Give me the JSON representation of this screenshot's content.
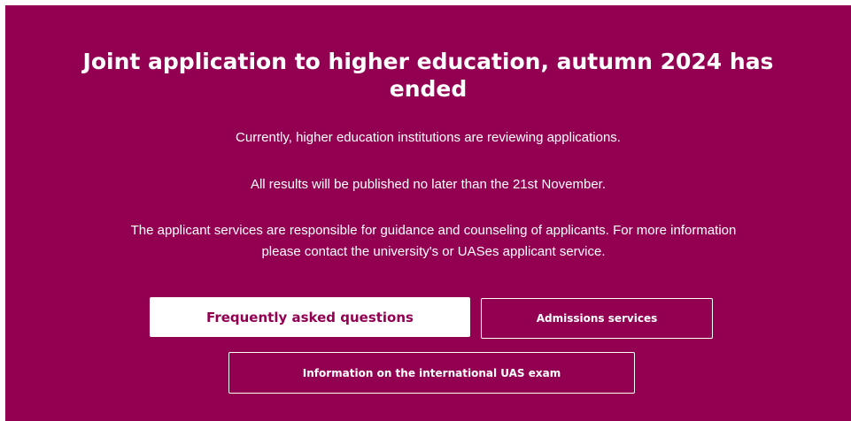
{
  "banner": {
    "title": "Joint application to higher education, autumn 2024 has ended",
    "paragraph_1": "Currently, higher education institutions are reviewing applications.",
    "paragraph_2": "All results will be published no later than the 21st November.",
    "paragraph_3_line_1": "The applicant services are responsible for guidance and counseling of applicants. For more information",
    "paragraph_3_line_2": "please contact the university's or UASes applicant service.",
    "buttons": {
      "faq": "Frequently asked questions",
      "admissions": "Admissions services",
      "international_exam": "Information on the international UAS exam"
    },
    "colors": {
      "background": "#930052",
      "text": "#ffffff"
    }
  }
}
